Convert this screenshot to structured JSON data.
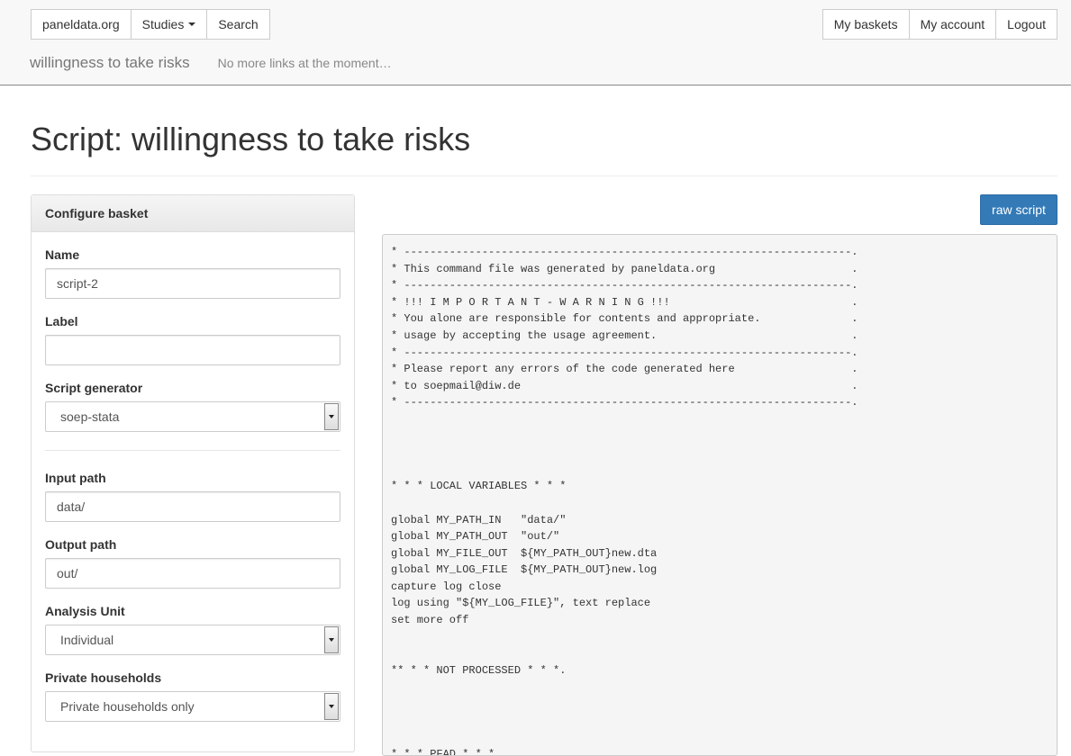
{
  "nav": {
    "brand": "paneldata.org",
    "studies": "Studies",
    "search": "Search",
    "my_baskets": "My baskets",
    "my_account": "My account",
    "logout": "Logout"
  },
  "subnav": {
    "title": "willingness to take risks",
    "note": "No more links at the moment…"
  },
  "page": {
    "title": "Script: willingness to take risks"
  },
  "panel": {
    "heading": "Configure basket",
    "name_label": "Name",
    "name_value": "script-2",
    "label_label": "Label",
    "label_value": "",
    "generator_label": "Script generator",
    "generator_value": "soep-stata",
    "input_path_label": "Input path",
    "input_path_value": "data/",
    "output_path_label": "Output path",
    "output_path_value": "out/",
    "analysis_unit_label": "Analysis Unit",
    "analysis_unit_value": "Individual",
    "private_households_label": "Private households",
    "private_households_value": "Private households only"
  },
  "script": {
    "raw_button": "raw script",
    "code": "* ---------------------------------------------------------------------.\n* This command file was generated by paneldata.org                     .\n* ---------------------------------------------------------------------.\n* !!! I M P O R T A N T - W A R N I N G !!!                            .\n* You alone are responsible for contents and appropriate.              .\n* usage by accepting the usage agreement.                              .\n* ---------------------------------------------------------------------.\n* Please report any errors of the code generated here                  .\n* to soepmail@diw.de                                                   .\n* ---------------------------------------------------------------------.\n\n\n\n\n* * * LOCAL VARIABLES * * *\n\nglobal MY_PATH_IN   \"data/\"\nglobal MY_PATH_OUT  \"out/\"\nglobal MY_FILE_OUT  ${MY_PATH_OUT}new.dta\nglobal MY_LOG_FILE  ${MY_PATH_OUT}new.log\ncapture log close\nlog using \"${MY_LOG_FILE}\", text replace\nset more off\n\n\n** * * NOT PROCESSED * * *.\n\n\n\n\n* * * PFAD * * *"
  }
}
